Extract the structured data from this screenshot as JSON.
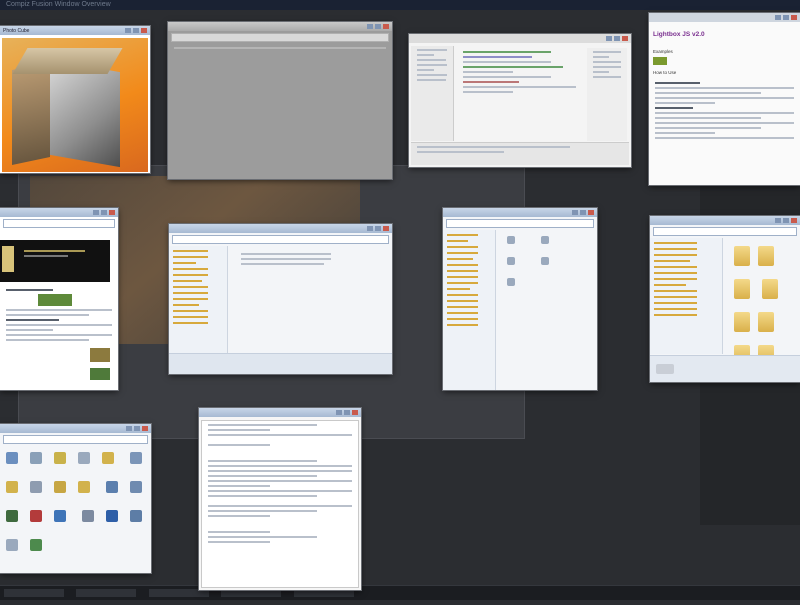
{
  "desktop": {
    "title_bar_text": "Compiz Fusion Window Overview"
  },
  "windows": [
    {
      "id": "photo-cube",
      "title": "Photo Cube"
    },
    {
      "id": "blank-browser",
      "title": ""
    },
    {
      "id": "code-editor",
      "title": ""
    },
    {
      "id": "lightbox-doc",
      "title": "",
      "heading": "Lightbox JS v2.0",
      "subhead1": "Examples",
      "subhead2": "How to Use"
    },
    {
      "id": "web-page",
      "title": ""
    },
    {
      "id": "explorer-1",
      "title": ""
    },
    {
      "id": "explorer-2",
      "title": ""
    },
    {
      "id": "explorer-3",
      "title": ""
    },
    {
      "id": "control-panel",
      "title": ""
    },
    {
      "id": "notepad",
      "title": ""
    }
  ],
  "colors": {
    "background": "#2b2d31",
    "accent_title": "#a6b9d2",
    "heading_purple": "#7a2f8f"
  }
}
